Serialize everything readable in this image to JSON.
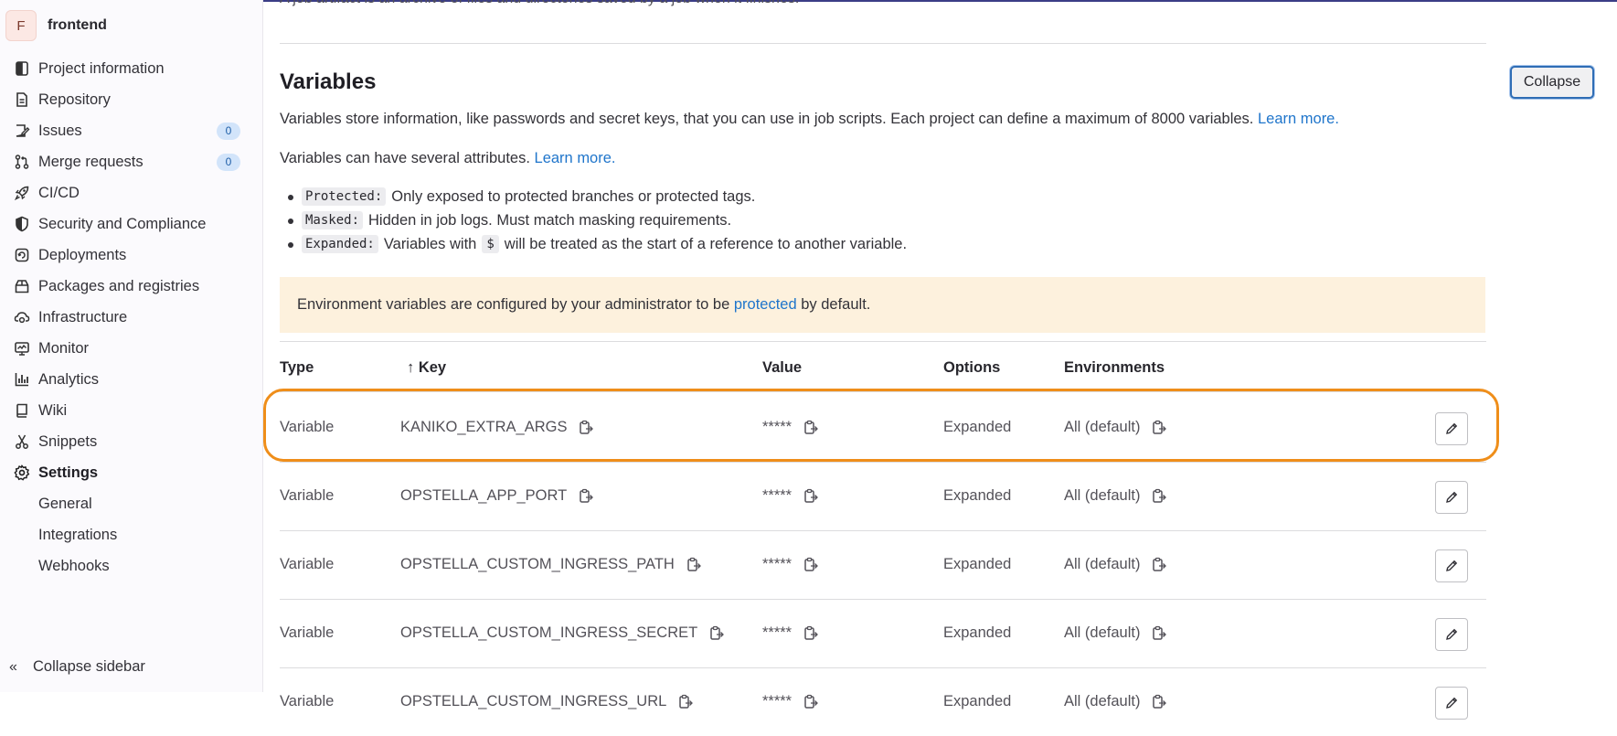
{
  "sidebar": {
    "project_initial": "F",
    "project_name": "frontend",
    "items": [
      {
        "label": "Project information",
        "icon": "project-info-icon"
      },
      {
        "label": "Repository",
        "icon": "document-icon"
      },
      {
        "label": "Issues",
        "icon": "issues-icon",
        "badge": "0"
      },
      {
        "label": "Merge requests",
        "icon": "merge-request-icon",
        "badge": "0"
      },
      {
        "label": "CI/CD",
        "icon": "rocket-icon"
      },
      {
        "label": "Security and Compliance",
        "icon": "shield-icon"
      },
      {
        "label": "Deployments",
        "icon": "deployments-icon"
      },
      {
        "label": "Packages and registries",
        "icon": "package-icon"
      },
      {
        "label": "Infrastructure",
        "icon": "cloud-gear-icon"
      },
      {
        "label": "Monitor",
        "icon": "monitor-icon"
      },
      {
        "label": "Analytics",
        "icon": "chart-icon"
      },
      {
        "label": "Wiki",
        "icon": "book-icon"
      },
      {
        "label": "Snippets",
        "icon": "scissors-icon"
      },
      {
        "label": "Settings",
        "icon": "gear-icon"
      }
    ],
    "settings_sub": [
      "General",
      "Integrations",
      "Webhooks"
    ],
    "collapse_label": "Collapse sidebar"
  },
  "main": {
    "cut_text": "A job artifact is an archive of files and directories saved by a job when it finishes.",
    "title": "Variables",
    "collapse_button": "Collapse",
    "desc1": "Variables store information, like passwords and secret keys, that you can use in job scripts. Each project can define a maximum of 8000 variables.",
    "learn_more": "Learn more.",
    "desc2": "Variables can have several attributes.",
    "attributes": [
      {
        "code": "Protected:",
        "text": "Only exposed to protected branches or protected tags."
      },
      {
        "code": "Masked:",
        "text": "Hidden in job logs. Must match masking requirements."
      },
      {
        "code": "Expanded:",
        "text_before": "Variables with",
        "inline_code": "$",
        "text_after": "will be treated as the start of a reference to another variable."
      }
    ],
    "alert": {
      "before": "Environment variables are configured by your administrator to be",
      "link": "protected",
      "after": "by default."
    }
  },
  "table": {
    "headers": {
      "type": "Type",
      "key": "Key",
      "key_sort_icon": "↑",
      "value": "Value",
      "options": "Options",
      "environments": "Environments"
    },
    "rows": [
      {
        "type": "Variable",
        "key": "KANIKO_EXTRA_ARGS",
        "value": "*****",
        "options": "Expanded",
        "env": "All (default)"
      },
      {
        "type": "Variable",
        "key": "OPSTELLA_APP_PORT",
        "value": "*****",
        "options": "Expanded",
        "env": "All (default)"
      },
      {
        "type": "Variable",
        "key": "OPSTELLA_CUSTOM_INGRESS_PATH",
        "value": "*****",
        "options": "Expanded",
        "env": "All (default)"
      },
      {
        "type": "Variable",
        "key": "OPSTELLA_CUSTOM_INGRESS_SECRET",
        "value": "*****",
        "options": "Expanded",
        "env": "All (default)"
      },
      {
        "type": "Variable",
        "key": "OPSTELLA_CUSTOM_INGRESS_URL",
        "value": "*****",
        "options": "Expanded",
        "env": "All (default)"
      }
    ]
  },
  "colors": {
    "link": "#1f75cb",
    "highlight": "#ef8e1a",
    "alert_bg": "#fdf1dd"
  }
}
